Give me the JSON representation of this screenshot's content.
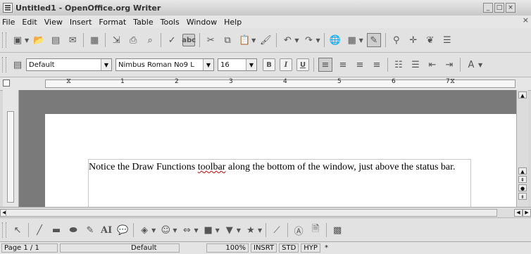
{
  "window": {
    "title": "Untitled1 - OpenOffice.org Writer",
    "buttons": [
      "_",
      "□",
      "×"
    ]
  },
  "menubar": {
    "items": [
      "File",
      "Edit",
      "View",
      "Insert",
      "Format",
      "Table",
      "Tools",
      "Window",
      "Help"
    ],
    "close": "×"
  },
  "format_toolbar": {
    "style": "Default",
    "font_name": "Nimbus Roman No9 L",
    "font_size": "16",
    "bold": "B",
    "italic": "I",
    "underline": "U"
  },
  "ruler": {
    "labels": [
      "1",
      "2",
      "3",
      "4",
      "5",
      "6",
      "7"
    ]
  },
  "document": {
    "text_before": "Notice the Draw Functions ",
    "text_misspelled": "toolbar",
    "text_after": " along the bottom of the window, just above the status bar."
  },
  "draw_toolbar": {
    "text_tool": "AI"
  },
  "statusbar": {
    "page": "Page 1 / 1",
    "page_style": "Default",
    "zoom": "100%",
    "insert_mode": "INSRT",
    "selection_mode": "STD",
    "hyperlink_mode": "HYP",
    "signature": "*"
  }
}
